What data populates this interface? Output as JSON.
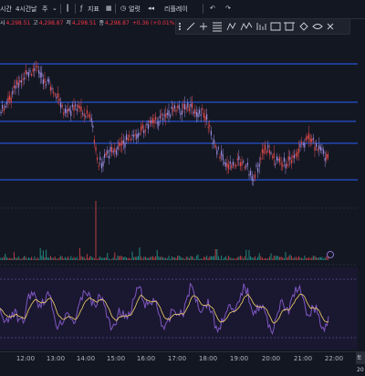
{
  "toolbar": {
    "interval_left": "시간",
    "interval_active": "4시간",
    "period_day": "날",
    "period_week": "주",
    "indicators_label": "지표",
    "alert_label": "얼럿",
    "replay_label": "리플레이"
  },
  "ohlc": {
    "o_label": "시",
    "o_value": "4,298.51",
    "h_label": "고",
    "h_value": "4,298.87",
    "l_label": "저",
    "l_value": "4,298.51",
    "c_label": "종",
    "c_value": "4,298.87",
    "change": "+0.36 (+0.01%"
  },
  "colors": {
    "background": "#131722",
    "candle_up": "#9c8ade",
    "candle_down": "#e04a4a",
    "hline": "#2962ff",
    "volume": "#26a69a",
    "rsi": "#7e57c2",
    "rsi_signal": "#f5d36b"
  },
  "time_axis": {
    "ticks": [
      "12:00",
      "13:00",
      "14:00",
      "15:00",
      "16:00",
      "17:00",
      "18:00",
      "19:00",
      "20:00",
      "21:00",
      "22:00"
    ],
    "corner": "토 20"
  },
  "icons": [
    "chart-type-icon",
    "line-tool-icon",
    "trend-tool-icon",
    "fib-icon",
    "pattern-icon",
    "brush-icon",
    "text-icon",
    "measure-icon",
    "shape-icon",
    "eye-icon",
    "close-icon"
  ]
}
